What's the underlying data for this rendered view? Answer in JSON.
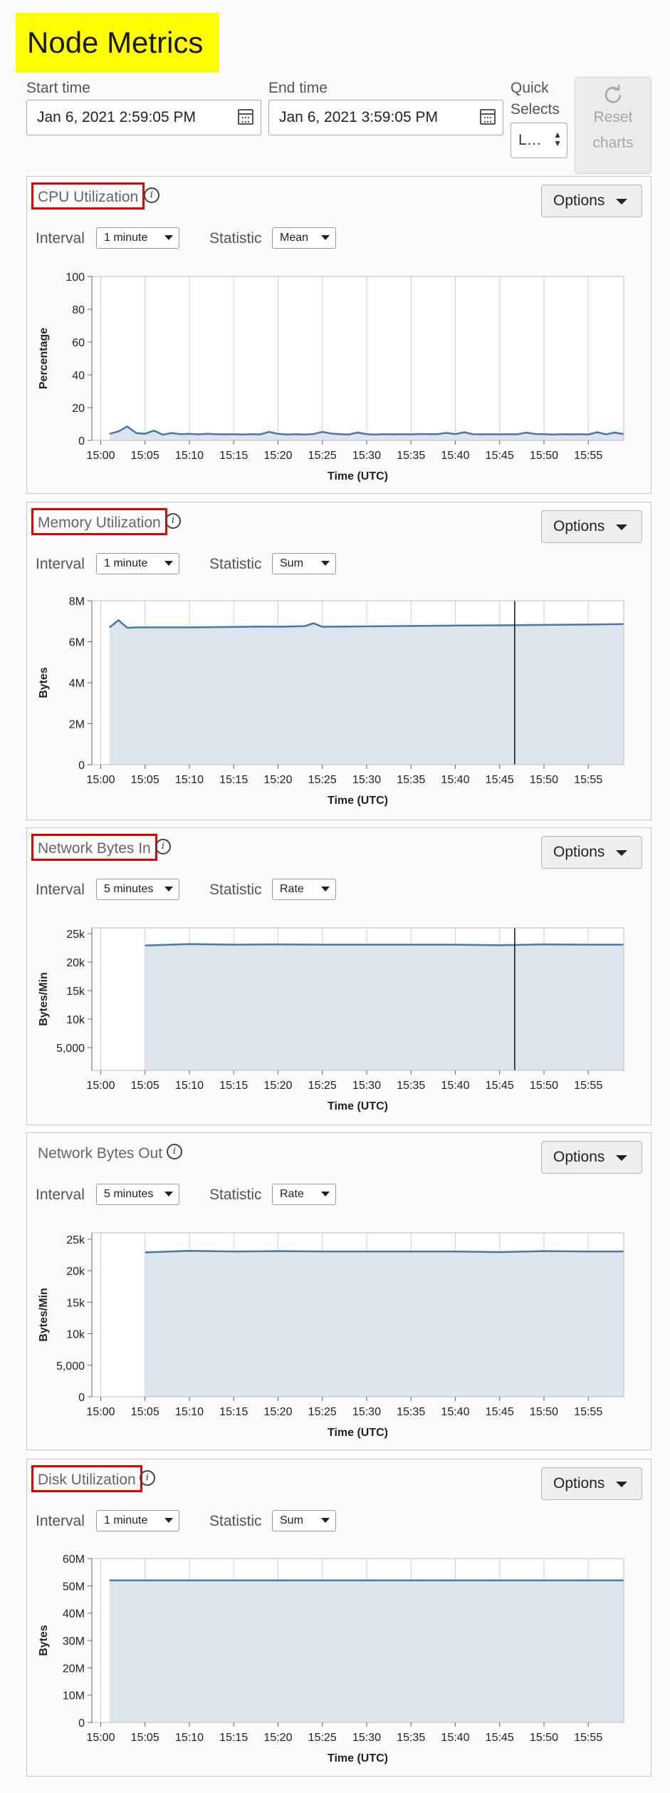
{
  "header": {
    "title": "Node Metrics",
    "start_label": "Start time",
    "start_value": "Jan 6, 2021 2:59:05 PM",
    "end_label": "End time",
    "end_value": "Jan 6, 2021 3:59:05 PM",
    "quick_label_1": "Quick",
    "quick_label_2": "Selects",
    "quick_value": "L…",
    "reset_line1": "Reset",
    "reset_line2": "charts"
  },
  "colors": {
    "line": "#4a76a8",
    "fill": "#dce4ee",
    "grid": "#d0d0d0",
    "highlight": "#e00000",
    "title_bg": "#ffff00"
  },
  "panels": [
    {
      "title": "CPU Utilization",
      "highlighted": true,
      "options_label": "Options",
      "interval_label": "Interval",
      "interval_value": "1 minute",
      "statistic_label": "Statistic",
      "statistic_value": "Mean"
    },
    {
      "title": "Memory Utilization",
      "highlighted": true,
      "options_label": "Options",
      "interval_label": "Interval",
      "interval_value": "1 minute",
      "statistic_label": "Statistic",
      "statistic_value": "Sum"
    },
    {
      "title": "Network Bytes In",
      "highlighted": true,
      "options_label": "Options",
      "interval_label": "Interval",
      "interval_value": "5 minutes",
      "statistic_label": "Statistic",
      "statistic_value": "Rate"
    },
    {
      "title": "Network Bytes Out",
      "highlighted": false,
      "options_label": "Options",
      "interval_label": "Interval",
      "interval_value": "5 minutes",
      "statistic_label": "Statistic",
      "statistic_value": "Rate"
    },
    {
      "title": "Disk Utilization",
      "highlighted": true,
      "options_label": "Options",
      "interval_label": "Interval",
      "interval_value": "1 minute",
      "statistic_label": "Statistic",
      "statistic_value": "Sum"
    }
  ],
  "chart_data": [
    {
      "type": "line",
      "ylabel": "Percentage",
      "xlabel": "Time (UTC)",
      "ylim": [
        0,
        100
      ],
      "yticks": [
        0,
        20,
        40,
        60,
        80,
        100
      ],
      "ytick_labels": [
        "0",
        "20",
        "40",
        "60",
        "80",
        "100"
      ],
      "xlim": [
        899,
        959
      ],
      "xticks": [
        900,
        905,
        910,
        915,
        920,
        925,
        930,
        935,
        940,
        945,
        950,
        955
      ],
      "xtick_labels": [
        "15:00",
        "15:05",
        "15:10",
        "15:15",
        "15:20",
        "15:25",
        "15:30",
        "15:35",
        "15:40",
        "15:45",
        "15:50",
        "15:55"
      ],
      "filled": true,
      "x": [
        901,
        902,
        903,
        904,
        905,
        906,
        907,
        908,
        909,
        910,
        911,
        912,
        913,
        914,
        915,
        916,
        917,
        918,
        919,
        920,
        921,
        922,
        923,
        924,
        925,
        926,
        927,
        928,
        929,
        930,
        931,
        932,
        933,
        934,
        935,
        936,
        937,
        938,
        939,
        940,
        941,
        942,
        943,
        944,
        945,
        946,
        947,
        948,
        949,
        950,
        951,
        952,
        953,
        954,
        955,
        956,
        957,
        958,
        959
      ],
      "y": [
        4,
        5.5,
        8.5,
        4.5,
        4,
        6,
        3.5,
        4.5,
        3.8,
        4,
        3.7,
        4,
        3.8,
        3.7,
        3.8,
        3.6,
        3.8,
        3.7,
        5.2,
        4,
        3.6,
        3.8,
        3.6,
        3.9,
        5.2,
        4.2,
        3.8,
        3.6,
        4.8,
        3.8,
        3.6,
        3.8,
        3.7,
        3.8,
        3.7,
        3.9,
        3.8,
        3.8,
        4.6,
        3.8,
        5,
        3.8,
        3.7,
        3.8,
        3.7,
        3.8,
        3.7,
        4.8,
        3.9,
        3.8,
        3.6,
        3.8,
        3.7,
        3.8,
        3.6,
        5,
        3.7,
        4.8,
        3.8
      ],
      "cursor_x": null
    },
    {
      "type": "area",
      "ylabel": "Bytes",
      "xlabel": "Time (UTC)",
      "ylim": [
        0,
        8000000
      ],
      "yticks": [
        0,
        2000000,
        4000000,
        6000000,
        8000000
      ],
      "ytick_labels": [
        "0",
        "2M",
        "4M",
        "6M",
        "8M"
      ],
      "xlim": [
        899,
        959
      ],
      "xticks": [
        900,
        905,
        910,
        915,
        920,
        925,
        930,
        935,
        940,
        945,
        950,
        955
      ],
      "xtick_labels": [
        "15:00",
        "15:05",
        "15:10",
        "15:15",
        "15:20",
        "15:25",
        "15:30",
        "15:35",
        "15:40",
        "15:45",
        "15:50",
        "15:55"
      ],
      "filled": true,
      "x": [
        901,
        902,
        903,
        904,
        905,
        910,
        915,
        918,
        920,
        923,
        924,
        925,
        930,
        935,
        940,
        945,
        950,
        955,
        959
      ],
      "y": [
        6700000,
        7050000,
        6680000,
        6700000,
        6700000,
        6700000,
        6720000,
        6740000,
        6730000,
        6760000,
        6900000,
        6730000,
        6750000,
        6770000,
        6790000,
        6800000,
        6820000,
        6840000,
        6860000
      ],
      "cursor_x": 946.7
    },
    {
      "type": "area",
      "ylabel": "Bytes/Min",
      "xlabel": "Time (UTC)",
      "ylim": [
        1000,
        26000
      ],
      "yticks": [
        5000,
        10000,
        15000,
        20000,
        25000
      ],
      "ytick_labels": [
        "5,000",
        "10k",
        "15k",
        "20k",
        "25k"
      ],
      "xlim": [
        899,
        959
      ],
      "xticks": [
        900,
        905,
        910,
        915,
        920,
        925,
        930,
        935,
        940,
        945,
        950,
        955
      ],
      "xtick_labels": [
        "15:00",
        "15:05",
        "15:10",
        "15:15",
        "15:20",
        "15:25",
        "15:30",
        "15:35",
        "15:40",
        "15:45",
        "15:50",
        "15:55"
      ],
      "filled": true,
      "x": [
        905,
        910,
        915,
        920,
        925,
        930,
        935,
        940,
        945,
        950,
        955,
        959
      ],
      "y": [
        22900,
        23150,
        23050,
        23100,
        23050,
        23050,
        23050,
        23050,
        22950,
        23100,
        23050,
        23050
      ],
      "cursor_x": 946.7
    },
    {
      "type": "area",
      "ylabel": "Bytes/Min",
      "xlabel": "Time (UTC)",
      "ylim": [
        0,
        26000
      ],
      "yticks": [
        0,
        5000,
        10000,
        15000,
        20000,
        25000
      ],
      "ytick_labels": [
        "0",
        "5,000",
        "10k",
        "15k",
        "20k",
        "25k"
      ],
      "xlim": [
        899,
        959
      ],
      "xticks": [
        900,
        905,
        910,
        915,
        920,
        925,
        930,
        935,
        940,
        945,
        950,
        955
      ],
      "xtick_labels": [
        "15:00",
        "15:05",
        "15:10",
        "15:15",
        "15:20",
        "15:25",
        "15:30",
        "15:35",
        "15:40",
        "15:45",
        "15:50",
        "15:55"
      ],
      "filled": true,
      "x": [
        905,
        910,
        915,
        920,
        925,
        930,
        935,
        940,
        945,
        950,
        955,
        959
      ],
      "y": [
        22900,
        23150,
        23050,
        23100,
        23050,
        23050,
        23050,
        23050,
        22950,
        23100,
        23050,
        23050
      ],
      "cursor_x": null
    },
    {
      "type": "area",
      "ylabel": "Bytes",
      "xlabel": "Time (UTC)",
      "ylim": [
        0,
        60000000
      ],
      "yticks": [
        0,
        10000000,
        20000000,
        30000000,
        40000000,
        50000000,
        60000000
      ],
      "ytick_labels": [
        "0",
        "10M",
        "20M",
        "30M",
        "40M",
        "50M",
        "60M"
      ],
      "xlim": [
        899,
        959
      ],
      "xticks": [
        900,
        905,
        910,
        915,
        920,
        925,
        930,
        935,
        940,
        945,
        950,
        955
      ],
      "xtick_labels": [
        "15:00",
        "15:05",
        "15:10",
        "15:15",
        "15:20",
        "15:25",
        "15:30",
        "15:35",
        "15:40",
        "15:45",
        "15:50",
        "15:55"
      ],
      "filled": true,
      "x": [
        901,
        959
      ],
      "y": [
        52000000,
        52000000
      ],
      "cursor_x": null
    }
  ]
}
